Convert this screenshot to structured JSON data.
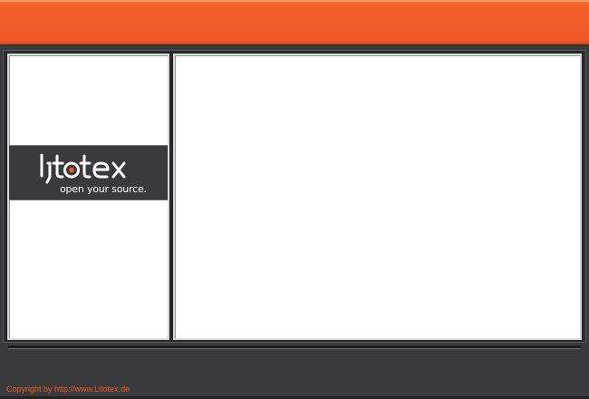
{
  "header": {
    "background": "#f0592a"
  },
  "sidebar": {
    "logo": {
      "wordmark": "litotex",
      "tagline": "open your source.",
      "accent": "#f05a24"
    }
  },
  "content": {
    "background": "#ffffff"
  },
  "footer": {
    "copyright_prefix": "Copyright by ",
    "copyright_link": "http://www.Litotex.de",
    "text_color": "#f05a24"
  }
}
